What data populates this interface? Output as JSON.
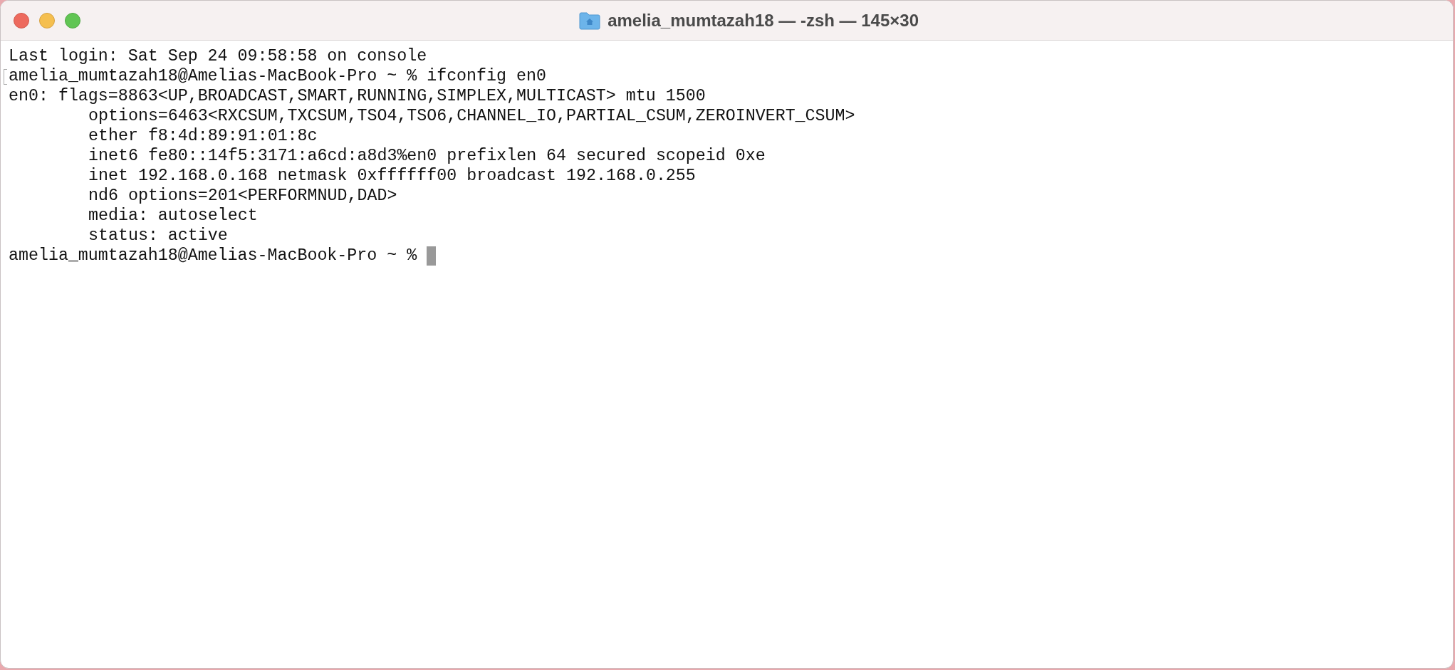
{
  "window": {
    "title": "amelia_mumtazah18 — -zsh — 145×30"
  },
  "terminal": {
    "lines": [
      {
        "kind": "output",
        "text": "Last login: Sat Sep 24 09:58:58 on console"
      },
      {
        "kind": "command",
        "text": "amelia_mumtazah18@Amelias-MacBook-Pro ~ % ifconfig en0"
      },
      {
        "kind": "output",
        "text": "en0: flags=8863<UP,BROADCAST,SMART,RUNNING,SIMPLEX,MULTICAST> mtu 1500"
      },
      {
        "kind": "detail",
        "text": "options=6463<RXCSUM,TXCSUM,TSO4,TSO6,CHANNEL_IO,PARTIAL_CSUM,ZEROINVERT_CSUM>"
      },
      {
        "kind": "detail",
        "text": "ether f8:4d:89:91:01:8c"
      },
      {
        "kind": "detail",
        "text": "inet6 fe80::14f5:3171:a6cd:a8d3%en0 prefixlen 64 secured scopeid 0xe"
      },
      {
        "kind": "detail",
        "text": "inet 192.168.0.168 netmask 0xffffff00 broadcast 192.168.0.255"
      },
      {
        "kind": "detail",
        "text": "nd6 options=201<PERFORMNUD,DAD>"
      },
      {
        "kind": "detail",
        "text": "media: autoselect"
      },
      {
        "kind": "detail",
        "text": "status: active"
      },
      {
        "kind": "prompt",
        "text": "amelia_mumtazah18@Amelias-MacBook-Pro ~ %"
      }
    ]
  }
}
